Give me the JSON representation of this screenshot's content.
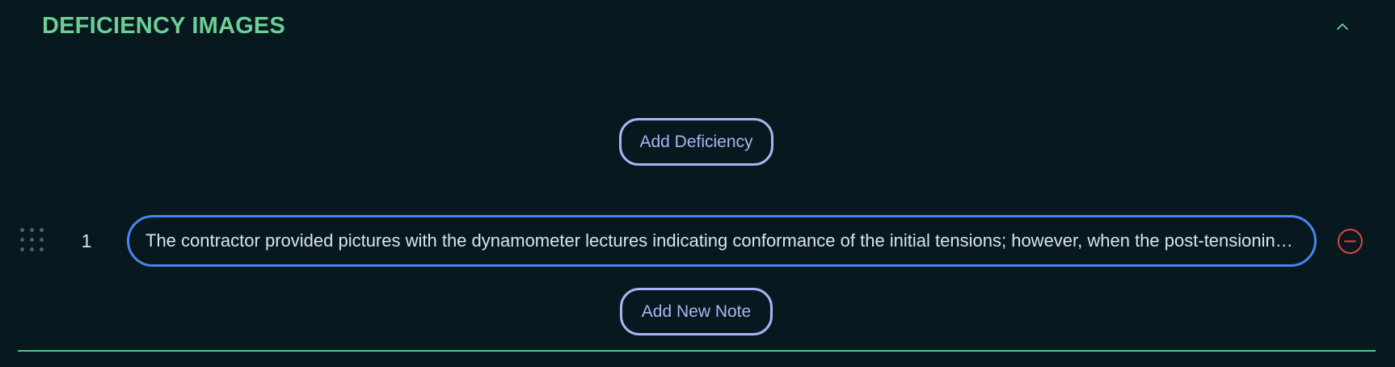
{
  "section": {
    "title": "DEFICIENCY IMAGES",
    "collapse_icon": "chevron-up-icon",
    "accent_color": "#6ccf95"
  },
  "actions": {
    "add_deficiency_label": "Add Deficiency",
    "add_note_label": "Add New Note",
    "button_color": "#aab4f4"
  },
  "notes": [
    {
      "index": "1",
      "text": "The contractor provided pictures with the dynamometer lectures indicating conformance of the initial tensions; however, when the post-tensioning was verified, several strands did not meet the specified values.",
      "drag_icon": "drag-handle-icon",
      "remove_icon": "minus-circle-icon",
      "remove_color": "#e0443d",
      "input_border_color": "#4a84f0"
    }
  ]
}
